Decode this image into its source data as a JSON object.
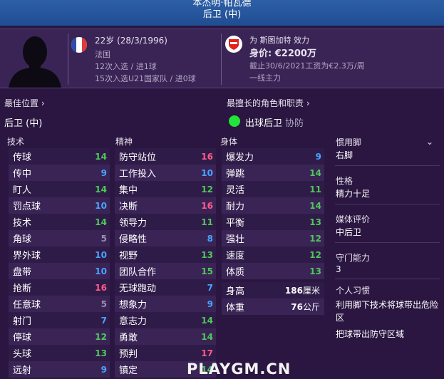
{
  "header": {
    "name": "本杰明·帕瓦德",
    "position": "后卫 (中)"
  },
  "profile": {
    "age_dob": "22岁 (28/3/1996)",
    "nationality": "法国",
    "caps": "12次入选 / 进1球",
    "u21_caps": "15次入选U21国家队 / 进0球",
    "club_line": "为 斯图加特 效力",
    "value": "身价: €2200万",
    "contract": "截止30/6/2021工资为€2.3万/周",
    "squad_status": "一线主力",
    "flag_colors": [
      "#2b4ea8",
      "#ffffff",
      "#e03a3a"
    ],
    "club_color": "#e32219"
  },
  "best_position": {
    "header": "最佳位置",
    "value": "后卫 (中)"
  },
  "best_role": {
    "header": "最擅长的角色和职责",
    "role": "出球后卫",
    "duty": "协防"
  },
  "columns": {
    "technical": "技术",
    "mental": "精神",
    "physical": "身体"
  },
  "technical": [
    {
      "label": "传球",
      "value": "14",
      "color": "#4fc85a"
    },
    {
      "label": "传中",
      "value": "9",
      "color": "#4aa3ff"
    },
    {
      "label": "盯人",
      "value": "14",
      "color": "#4fc85a"
    },
    {
      "label": "罚点球",
      "value": "10",
      "color": "#4aa3ff"
    },
    {
      "label": "技术",
      "value": "14",
      "color": "#4fc85a"
    },
    {
      "label": "角球",
      "value": "5",
      "color": "#9a8fae"
    },
    {
      "label": "界外球",
      "value": "10",
      "color": "#4aa3ff"
    },
    {
      "label": "盘带",
      "value": "10",
      "color": "#4aa3ff"
    },
    {
      "label": "抢断",
      "value": "16",
      "color": "#ff5a8a"
    },
    {
      "label": "任意球",
      "value": "5",
      "color": "#9a8fae"
    },
    {
      "label": "射门",
      "value": "7",
      "color": "#4aa3ff"
    },
    {
      "label": "停球",
      "value": "12",
      "color": "#4fc85a"
    },
    {
      "label": "头球",
      "value": "13",
      "color": "#4fc85a"
    },
    {
      "label": "远射",
      "value": "9",
      "color": "#4aa3ff"
    }
  ],
  "mental": [
    {
      "label": "防守站位",
      "value": "16",
      "color": "#ff5a8a"
    },
    {
      "label": "工作投入",
      "value": "10",
      "color": "#4aa3ff"
    },
    {
      "label": "集中",
      "value": "12",
      "color": "#4fc85a"
    },
    {
      "label": "决断",
      "value": "16",
      "color": "#ff5a8a"
    },
    {
      "label": "领导力",
      "value": "11",
      "color": "#4fc85a"
    },
    {
      "label": "侵略性",
      "value": "8",
      "color": "#4aa3ff"
    },
    {
      "label": "视野",
      "value": "13",
      "color": "#4fc85a"
    },
    {
      "label": "团队合作",
      "value": "15",
      "color": "#4fc85a"
    },
    {
      "label": "无球跑动",
      "value": "7",
      "color": "#4aa3ff"
    },
    {
      "label": "想象力",
      "value": "9",
      "color": "#4aa3ff"
    },
    {
      "label": "意志力",
      "value": "14",
      "color": "#4fc85a"
    },
    {
      "label": "勇敢",
      "value": "14",
      "color": "#4fc85a"
    },
    {
      "label": "预判",
      "value": "17",
      "color": "#ff5a8a"
    },
    {
      "label": "镇定",
      "value": "14",
      "color": "#4fc85a"
    }
  ],
  "physical": [
    {
      "label": "爆发力",
      "value": "9",
      "color": "#4aa3ff"
    },
    {
      "label": "弹跳",
      "value": "14",
      "color": "#4fc85a"
    },
    {
      "label": "灵活",
      "value": "11",
      "color": "#4fc85a"
    },
    {
      "label": "耐力",
      "value": "14",
      "color": "#4fc85a"
    },
    {
      "label": "平衡",
      "value": "13",
      "color": "#4fc85a"
    },
    {
      "label": "强壮",
      "value": "12",
      "color": "#4fc85a"
    },
    {
      "label": "速度",
      "value": "12",
      "color": "#4fc85a"
    },
    {
      "label": "体质",
      "value": "13",
      "color": "#4fc85a"
    }
  ],
  "body": {
    "height_label": "身高",
    "height_value": "186",
    "height_unit": "厘米",
    "weight_label": "体重",
    "weight_value": "76",
    "weight_unit": "公斤"
  },
  "info": {
    "foot_label": "惯用脚",
    "foot_value": "右脚",
    "personality_label": "性格",
    "personality_value": "精力十足",
    "media_label": "媒体评价",
    "media_value": "中后卫",
    "gk_label": "守门能力",
    "gk_value": "3",
    "habits_label": "个人习惯",
    "habit1": "利用脚下技术将球带出危险区",
    "habit2": "把球带出防守区域"
  },
  "watermark": "PLAYGM.CN"
}
